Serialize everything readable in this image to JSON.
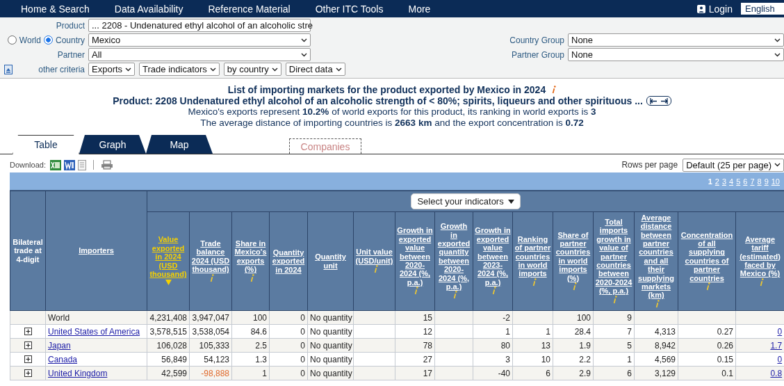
{
  "nav": {
    "items": [
      "Home & Search",
      "Data Availability",
      "Reference Material",
      "Other ITC Tools",
      "More"
    ],
    "login": "Login",
    "language": "English"
  },
  "filters": {
    "product_label": "Product",
    "product": "... 2208 - Undenatured ethyl alcohol of an alcoholic stre",
    "scope": [
      {
        "label": "World",
        "selected": false
      },
      {
        "label": "Country",
        "selected": true
      }
    ],
    "country": "Mexico",
    "partner_label": "Partner",
    "partner": "All",
    "other_label": "other criteria",
    "other": [
      "Exports",
      "Trade indicators",
      "by country",
      "Direct data"
    ],
    "country_group_label": "Country Group",
    "country_group": "None",
    "partner_group_label": "Partner Group",
    "partner_group": "None"
  },
  "heading": {
    "title": "List of importing markets for the product exported by Mexico in 2024",
    "product": "Product: 2208 Undenatured ethyl alcohol of an alcoholic strength of < 80%; spirits, liqueurs and other spirituous ...",
    "lines": [
      "Mexico's exports represent **10.2%** of world exports for this product, its ranking in world exports is **3**",
      "The average distance of importing countries is **2663 km** and the export concentration is **0.72**"
    ]
  },
  "tabs": [
    {
      "label": "Table",
      "selected": true,
      "disabled": false
    },
    {
      "label": "Graph",
      "selected": false,
      "disabled": false
    },
    {
      "label": "Map",
      "selected": false,
      "disabled": false
    },
    {
      "label": "Companies",
      "selected": false,
      "disabled": true
    }
  ],
  "download": {
    "label": "Download:"
  },
  "rows_per_page": {
    "label": "Rows per page",
    "value": "Default (25 per page)"
  },
  "pagination": [
    {
      "label": "1",
      "selected": true
    },
    {
      "label": "2",
      "selected": false
    },
    {
      "label": "3",
      "selected": false
    },
    {
      "label": "4",
      "selected": false
    },
    {
      "label": "5",
      "selected": false
    },
    {
      "label": "6",
      "selected": false
    },
    {
      "label": "7",
      "selected": false
    },
    {
      "label": "8",
      "selected": false
    },
    {
      "label": "9",
      "selected": false
    },
    {
      "label": "10",
      "selected": false
    }
  ],
  "table": {
    "bilateral_header": "Bilateral trade at 4-digit",
    "importers_header": "Importers",
    "indicator_button": "Select your indicators",
    "columns": [
      {
        "label": "Value exported in 2024 (USD thousand)",
        "info": false,
        "sorted": true
      },
      {
        "label": "Trade balance 2024 (USD thousand)",
        "info": true,
        "sorted": false
      },
      {
        "label": "Share in Mexico's exports (%)",
        "info": true,
        "sorted": false
      },
      {
        "label": "Quantity exported in 2024",
        "info": false,
        "sorted": false
      },
      {
        "label": "Quantity unit",
        "info": false,
        "sorted": false
      },
      {
        "label": "Unit value (USD/unit)",
        "info": true,
        "sorted": false
      },
      {
        "label": "Growth in exported value between 2020-2024 (%, p.a.)",
        "info": true,
        "sorted": false
      },
      {
        "label": "Growth in exported quantity between 2020-2024 (%, p.a.)",
        "info": true,
        "sorted": false
      },
      {
        "label": "Growth in exported value between 2023-2024 (%, p.a.)",
        "info": true,
        "sorted": false
      },
      {
        "label": "Ranking of partner countries in world imports",
        "info": true,
        "sorted": false
      },
      {
        "label": "Share of partner countries in world imports (%)",
        "info": true,
        "sorted": false
      },
      {
        "label": "Total imports growth in value of partner countries between 2020-2024 (%, p.a.)",
        "info": true,
        "sorted": false
      },
      {
        "label": "Average distance between partner countries and all their supplying markets (km)",
        "info": true,
        "sorted": false
      },
      {
        "label": "Concentration of all supplying countries of partner countries",
        "info": true,
        "sorted": false
      },
      {
        "label": "Average tariff (estimated) faced by Mexico (%)",
        "info": true,
        "sorted": false
      }
    ],
    "rows": [
      {
        "importer": "World",
        "expandable": false,
        "balance_negative": false,
        "value_2024": "4,231,408",
        "trade_balance": "3,947,047",
        "share": "100",
        "quantity": "0",
        "quantity_unit": "No quantity",
        "growth_value_2020_2024": "15",
        "growth_value_2023_2024": "-2",
        "partner_share": "100",
        "partner_import_growth": "9"
      },
      {
        "importer": "United States of America",
        "expandable": true,
        "balance_negative": false,
        "value_2024": "3,578,515",
        "trade_balance": "3,538,054",
        "share": "84.6",
        "quantity": "0",
        "quantity_unit": "No quantity",
        "growth_value_2020_2024": "12",
        "growth_value_2023_2024": "1",
        "ranking": "1",
        "partner_share": "28.4",
        "partner_import_growth": "7",
        "distance": "4,313",
        "concentration": "0.27",
        "tariff": "0"
      },
      {
        "importer": "Japan",
        "expandable": true,
        "balance_negative": false,
        "value_2024": "106,028",
        "trade_balance": "105,333",
        "share": "2.5",
        "quantity": "0",
        "quantity_unit": "No quantity",
        "growth_value_2020_2024": "78",
        "growth_value_2023_2024": "80",
        "ranking": "13",
        "partner_share": "1.9",
        "partner_import_growth": "5",
        "distance": "8,942",
        "concentration": "0.26",
        "tariff": "1.7"
      },
      {
        "importer": "Canada",
        "expandable": true,
        "balance_negative": false,
        "value_2024": "56,849",
        "trade_balance": "54,123",
        "share": "1.3",
        "quantity": "0",
        "quantity_unit": "No quantity",
        "growth_value_2020_2024": "27",
        "growth_value_2023_2024": "3",
        "ranking": "10",
        "partner_share": "2.2",
        "partner_import_growth": "1",
        "distance": "4,569",
        "concentration": "0.15",
        "tariff": "0"
      },
      {
        "importer": "United Kingdom",
        "expandable": true,
        "balance_negative": true,
        "value_2024": "42,599",
        "trade_balance": "-98,888",
        "share": "1",
        "quantity": "0",
        "quantity_unit": "No quantity",
        "growth_value_2020_2024": "17",
        "growth_value_2023_2024": "-40",
        "ranking": "6",
        "partner_share": "2.9",
        "partner_import_growth": "6",
        "distance": "3,129",
        "concentration": "0.1",
        "tariff": "0.8"
      }
    ]
  }
}
